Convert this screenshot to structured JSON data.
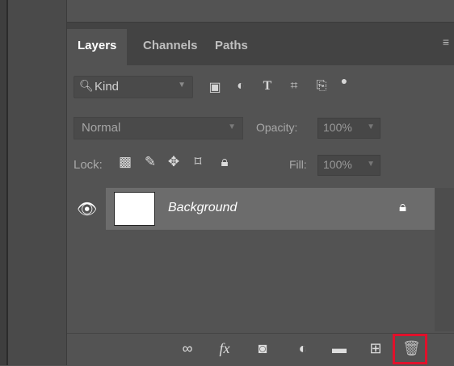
{
  "tabs": [
    "Layers",
    "Channels",
    "Paths"
  ],
  "panel_menu_icon": "hamburger-menu-icon",
  "filter": {
    "kind_label": "Kind",
    "icons": [
      "image-filter-icon",
      "adjustment-filter-icon",
      "type-filter-icon",
      "shape-filter-icon",
      "smart-object-filter-icon",
      "filter-toggle-icon"
    ]
  },
  "blend": {
    "mode": "Normal",
    "opacity_label": "Opacity:",
    "opacity_value": "100%"
  },
  "lock": {
    "label": "Lock:",
    "fill_label": "Fill:",
    "fill_value": "100%",
    "icons": [
      "lock-transparent-pixels-icon",
      "lock-image-pixels-icon",
      "lock-position-icon",
      "lock-artboard-icon",
      "lock-all-icon"
    ]
  },
  "layers": [
    {
      "name": "Background",
      "visible": true,
      "locked": true
    }
  ],
  "footer": {
    "buttons": [
      "link-layers-icon",
      "fx-icon",
      "add-mask-icon",
      "new-fill-adjustment-icon",
      "new-group-icon",
      "new-layer-icon",
      "delete-layer-icon"
    ],
    "fx_label": "fx",
    "highlight_color": "#e0112b"
  }
}
